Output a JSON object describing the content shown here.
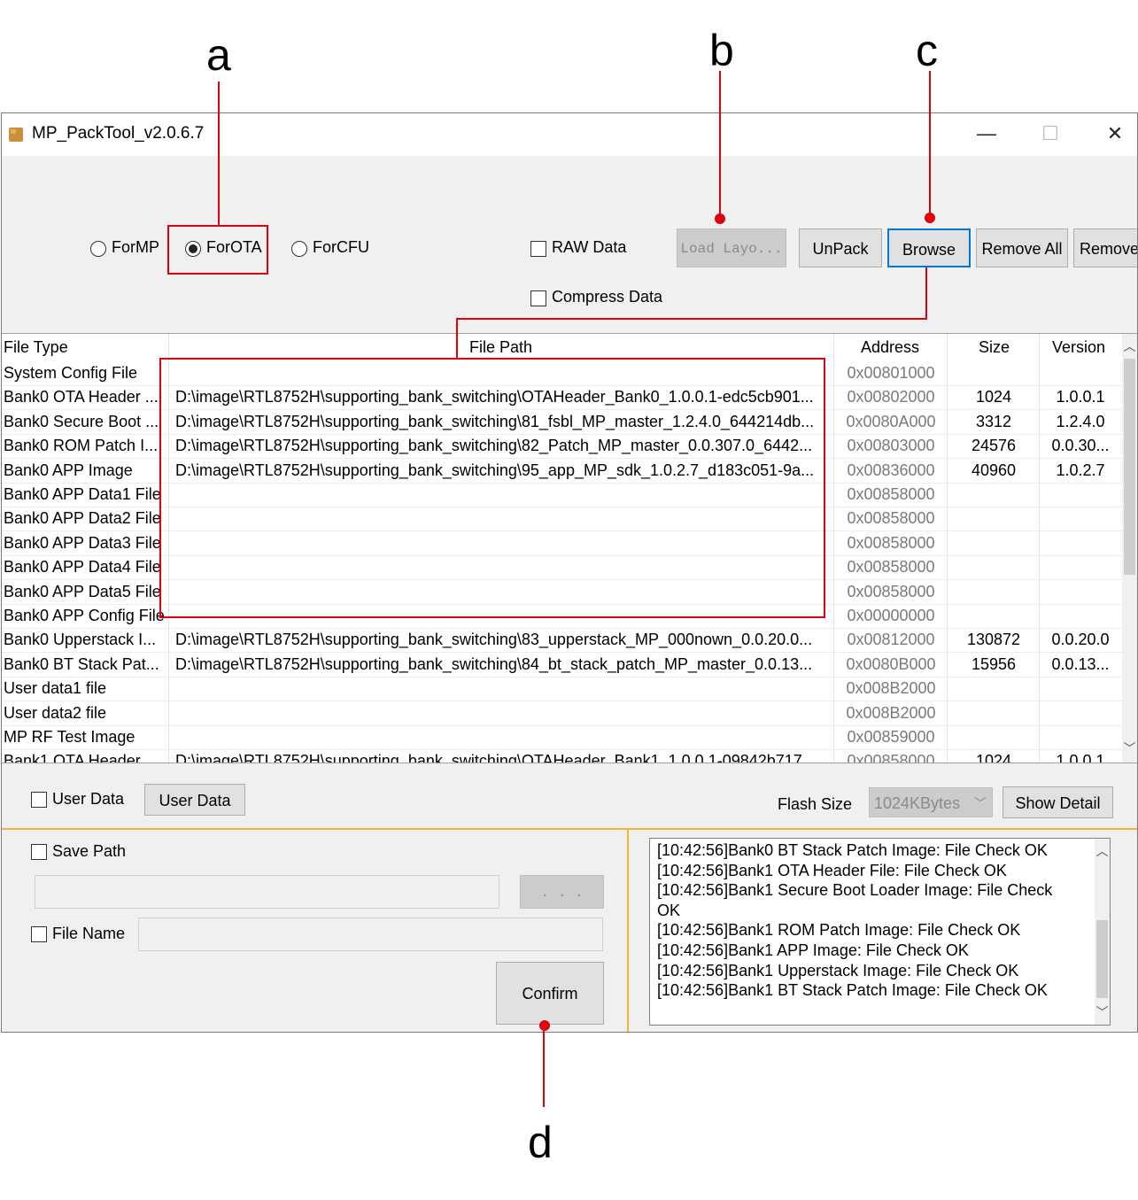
{
  "callouts": {
    "a": "a",
    "b": "b",
    "c": "c",
    "d": "d"
  },
  "window": {
    "title": "MP_PackTool_v2.0.6.7",
    "minimize": "—",
    "maximize": "☐",
    "close": "✕"
  },
  "mode": {
    "formp": "ForMP",
    "forota": "ForOTA",
    "forcfu": "ForCFU",
    "selected": "ForOTA"
  },
  "options": {
    "raw_data": "RAW Data",
    "compress_data": "Compress Data"
  },
  "toolbar": {
    "load_layout": "Load Layo...",
    "unpack": "UnPack",
    "browse": "Browse",
    "remove_all": "Remove All",
    "remove": "Remove"
  },
  "table": {
    "headers": {
      "type": "File Type",
      "path": "File Path",
      "address": "Address",
      "size": "Size",
      "version": "Version"
    },
    "rows": [
      {
        "type": "System Config File",
        "path": "",
        "address": "0x00801000",
        "size": "",
        "version": ""
      },
      {
        "type": "Bank0 OTA Header ...",
        "path": "D:\\image\\RTL8752H\\supporting_bank_switching\\OTAHeader_Bank0_1.0.0.1-edc5cb901...",
        "address": "0x00802000",
        "size": "1024",
        "version": "1.0.0.1"
      },
      {
        "type": "Bank0 Secure Boot ...",
        "path": "D:\\image\\RTL8752H\\supporting_bank_switching\\81_fsbl_MP_master_1.2.4.0_644214db...",
        "address": "0x0080A000",
        "size": "3312",
        "version": "1.2.4.0"
      },
      {
        "type": "Bank0 ROM Patch I...",
        "path": "D:\\image\\RTL8752H\\supporting_bank_switching\\82_Patch_MP_master_0.0.307.0_6442...",
        "address": "0x00803000",
        "size": "24576",
        "version": "0.0.30..."
      },
      {
        "type": "Bank0 APP Image",
        "path": "D:\\image\\RTL8752H\\supporting_bank_switching\\95_app_MP_sdk_1.0.2.7_d183c051-9a...",
        "address": "0x00836000",
        "size": "40960",
        "version": "1.0.2.7"
      },
      {
        "type": "Bank0 APP Data1 File",
        "path": "",
        "address": "0x00858000",
        "size": "",
        "version": ""
      },
      {
        "type": "Bank0 APP Data2 File",
        "path": "",
        "address": "0x00858000",
        "size": "",
        "version": ""
      },
      {
        "type": "Bank0 APP Data3 File",
        "path": "",
        "address": "0x00858000",
        "size": "",
        "version": ""
      },
      {
        "type": "Bank0 APP Data4 File",
        "path": "",
        "address": "0x00858000",
        "size": "",
        "version": ""
      },
      {
        "type": "Bank0 APP Data5 File",
        "path": "",
        "address": "0x00858000",
        "size": "",
        "version": ""
      },
      {
        "type": "Bank0 APP Config File",
        "path": "",
        "address": "0x00000000",
        "size": "",
        "version": ""
      },
      {
        "type": "Bank0 Upperstack I...",
        "path": "D:\\image\\RTL8752H\\supporting_bank_switching\\83_upperstack_MP_000nown_0.0.20.0...",
        "address": "0x00812000",
        "size": "130872",
        "version": "0.0.20.0"
      },
      {
        "type": "Bank0 BT Stack Pat...",
        "path": "D:\\image\\RTL8752H\\supporting_bank_switching\\84_bt_stack_patch_MP_master_0.0.13...",
        "address": "0x0080B000",
        "size": "15956",
        "version": "0.0.13..."
      },
      {
        "type": "User data1 file",
        "path": "",
        "address": "0x008B2000",
        "size": "",
        "version": ""
      },
      {
        "type": "User data2 file",
        "path": "",
        "address": "0x008B2000",
        "size": "",
        "version": ""
      },
      {
        "type": "MP RF Test Image",
        "path": "",
        "address": "0x00859000",
        "size": "",
        "version": ""
      },
      {
        "type": "Bank1 OTA Header ...",
        "path": "D:\\image\\RTL8752H\\supporting_bank_switching\\OTAHeader_Bank1_1.0.0.1-09842b717...",
        "address": "0x00858000",
        "size": "1024",
        "version": "1.0.0.1"
      }
    ]
  },
  "user_data": {
    "checkbox_label": "User Data",
    "button_label": "User Data"
  },
  "flash": {
    "label": "Flash Size",
    "value": "1024KBytes",
    "show_detail": "Show Detail"
  },
  "save": {
    "save_path_label": "Save Path",
    "browse_label": ". . .",
    "file_name_label": "File Name",
    "confirm": "Confirm"
  },
  "log": {
    "lines": [
      "[10:42:56]Bank0 BT Stack Patch Image: File Check OK",
      "[10:42:56]Bank1 OTA Header File: File Check OK",
      "[10:42:56]Bank1 Secure Boot Loader Image: File Check",
      "OK",
      "[10:42:56]Bank1 ROM Patch Image: File Check OK",
      "[10:42:56]Bank1 APP Image: File Check OK",
      "[10:42:56]Bank1 Upperstack Image: File Check OK",
      "[10:42:56]Bank1 BT Stack Patch Image: File Check OK"
    ]
  },
  "colors": {
    "annotation_red": "#e0000f",
    "focus_blue": "#0078d7",
    "separator_orange": "#f0b43c"
  }
}
